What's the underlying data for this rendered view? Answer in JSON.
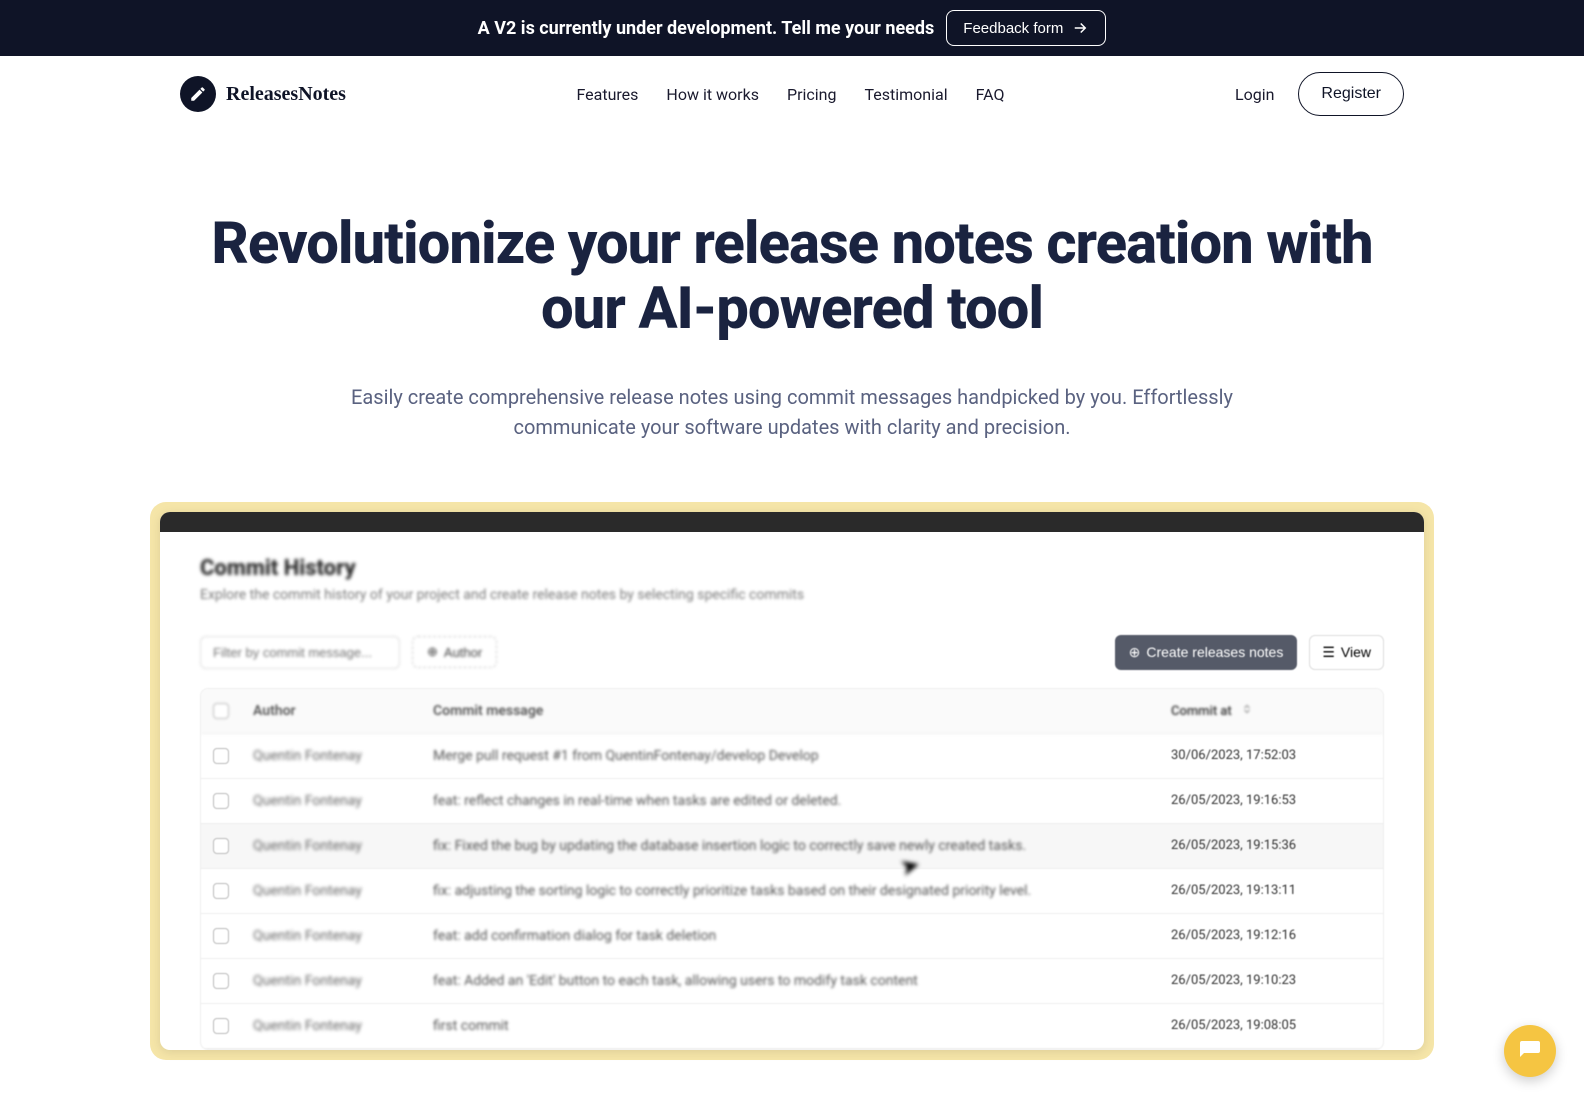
{
  "announcement": {
    "text": "A V2 is currently under development. Tell me your needs",
    "button": "Feedback form"
  },
  "brand": {
    "name": "ReleasesNotes"
  },
  "nav": {
    "items": [
      "Features",
      "How it works",
      "Pricing",
      "Testimonial",
      "FAQ"
    ],
    "login": "Login",
    "register": "Register"
  },
  "hero": {
    "title": "Revolutionize your release notes creation with our AI-powered tool",
    "subtitle": "Easily create comprehensive release notes using commit messages handpicked by you. Effortlessly communicate your software updates with clarity and precision."
  },
  "preview": {
    "title": "Commit History",
    "subtitle": "Explore the commit history of your project and create release notes by selecting specific commits",
    "filterPlaceholder": "Filter by commit message...",
    "authorFilter": "Author",
    "createBtn": "Create releases notes",
    "viewBtn": "View",
    "columns": {
      "author": "Author",
      "message": "Commit message",
      "date": "Commit at"
    },
    "rows": [
      {
        "author": "Quentin Fontenay",
        "message": "Merge pull request #1 from QuentinFontenay/develop Develop",
        "date": "30/06/2023, 17:52:03"
      },
      {
        "author": "Quentin Fontenay",
        "message": "feat: reflect changes in real-time when tasks are edited or deleted.",
        "date": "26/05/2023, 19:16:53"
      },
      {
        "author": "Quentin Fontenay",
        "message": "fix: Fixed the bug by updating the database insertion logic to correctly save newly created tasks.",
        "date": "26/05/2023, 19:15:36"
      },
      {
        "author": "Quentin Fontenay",
        "message": "fix: adjusting the sorting logic to correctly prioritize tasks based on their designated priority level.",
        "date": "26/05/2023, 19:13:11"
      },
      {
        "author": "Quentin Fontenay",
        "message": "feat: add confirmation dialog for task deletion",
        "date": "26/05/2023, 19:12:16"
      },
      {
        "author": "Quentin Fontenay",
        "message": "feat: Added an 'Edit' button to each task, allowing users to modify task content",
        "date": "26/05/2023, 19:10:23"
      },
      {
        "author": "Quentin Fontenay",
        "message": "first commit",
        "date": "26/05/2023, 19:08:05"
      }
    ]
  }
}
